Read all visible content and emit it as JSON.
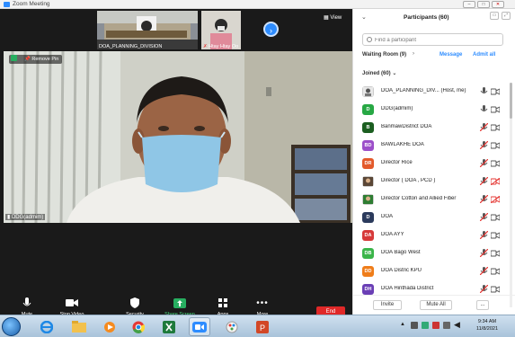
{
  "window": {
    "title": "Zoom Meeting",
    "controls": [
      "–",
      "□",
      "✕"
    ]
  },
  "meeting": {
    "thumbnails": [
      {
        "name": "DOA_PLANNING_DIVISION"
      },
      {
        "name": "Htay Htay Oo"
      }
    ],
    "view_label": "View",
    "pin_label": "Remove Pin",
    "active_speaker": "DDG(admim)"
  },
  "controls": {
    "mute": "Mute",
    "stop_video": "Stop Video",
    "security": "Security",
    "share_screen": "Share Screen",
    "apps": "Apps",
    "more": "More",
    "end": "End"
  },
  "participants_panel": {
    "title": "Participants (60)",
    "search_placeholder": "Find a participant",
    "waiting_room": "Waiting Room (9)",
    "message": "Message",
    "admit_all": "Admit all",
    "joined": "Joined (60)",
    "participants": [
      {
        "initials": "",
        "name": "DOA_PLANNING_DIV... (Host, me)",
        "color": "#ffffff",
        "avatar": "photo",
        "mic": "on",
        "cam": "off"
      },
      {
        "initials": "D",
        "name": "DDG(admim)",
        "color": "#27a844",
        "avatar": "initial",
        "mic": "on",
        "cam": "off"
      },
      {
        "initials": "B",
        "name": "BanmawDistrict DOA",
        "color": "#1b5e20",
        "avatar": "initial",
        "mic": "muted",
        "cam": "off"
      },
      {
        "initials": "BD",
        "name": "BAWLAKHE  DOA",
        "color": "#9c4fc9",
        "avatar": "initial",
        "mic": "muted",
        "cam": "off"
      },
      {
        "initials": "DR",
        "name": "Director  Rice",
        "color": "#e35a2b",
        "avatar": "initial",
        "mic": "muted",
        "cam": "off"
      },
      {
        "initials": "",
        "name": "Director ( DOA , PCD )",
        "color": "#5a4636",
        "avatar": "photo",
        "mic": "muted",
        "cam": "muted"
      },
      {
        "initials": "",
        "name": "Director Cotton and Allied Fiber",
        "color": "#2e7d32",
        "avatar": "photo",
        "mic": "muted",
        "cam": "muted"
      },
      {
        "initials": "D",
        "name": "DOA",
        "color": "#2b3a5c",
        "avatar": "initial",
        "mic": "muted",
        "cam": "off"
      },
      {
        "initials": "DA",
        "name": "DOA AYY",
        "color": "#d63a3a",
        "avatar": "initial",
        "mic": "muted",
        "cam": "off"
      },
      {
        "initials": "DB",
        "name": "DOA Bago West",
        "color": "#3bb54a",
        "avatar": "initial",
        "mic": "muted",
        "cam": "off"
      },
      {
        "initials": "DD",
        "name": "DOA Distric KPU",
        "color": "#ef7d1a",
        "avatar": "initial",
        "mic": "muted",
        "cam": "off"
      },
      {
        "initials": "DH",
        "name": "DOA Hinthada District",
        "color": "#6a3fb5",
        "avatar": "initial",
        "mic": "muted",
        "cam": "off"
      }
    ],
    "invite": "Invite",
    "mute_all": "Mute All",
    "more": "..."
  },
  "taskbar": {
    "time": "9:34 AM",
    "date": "11/8/2021"
  }
}
